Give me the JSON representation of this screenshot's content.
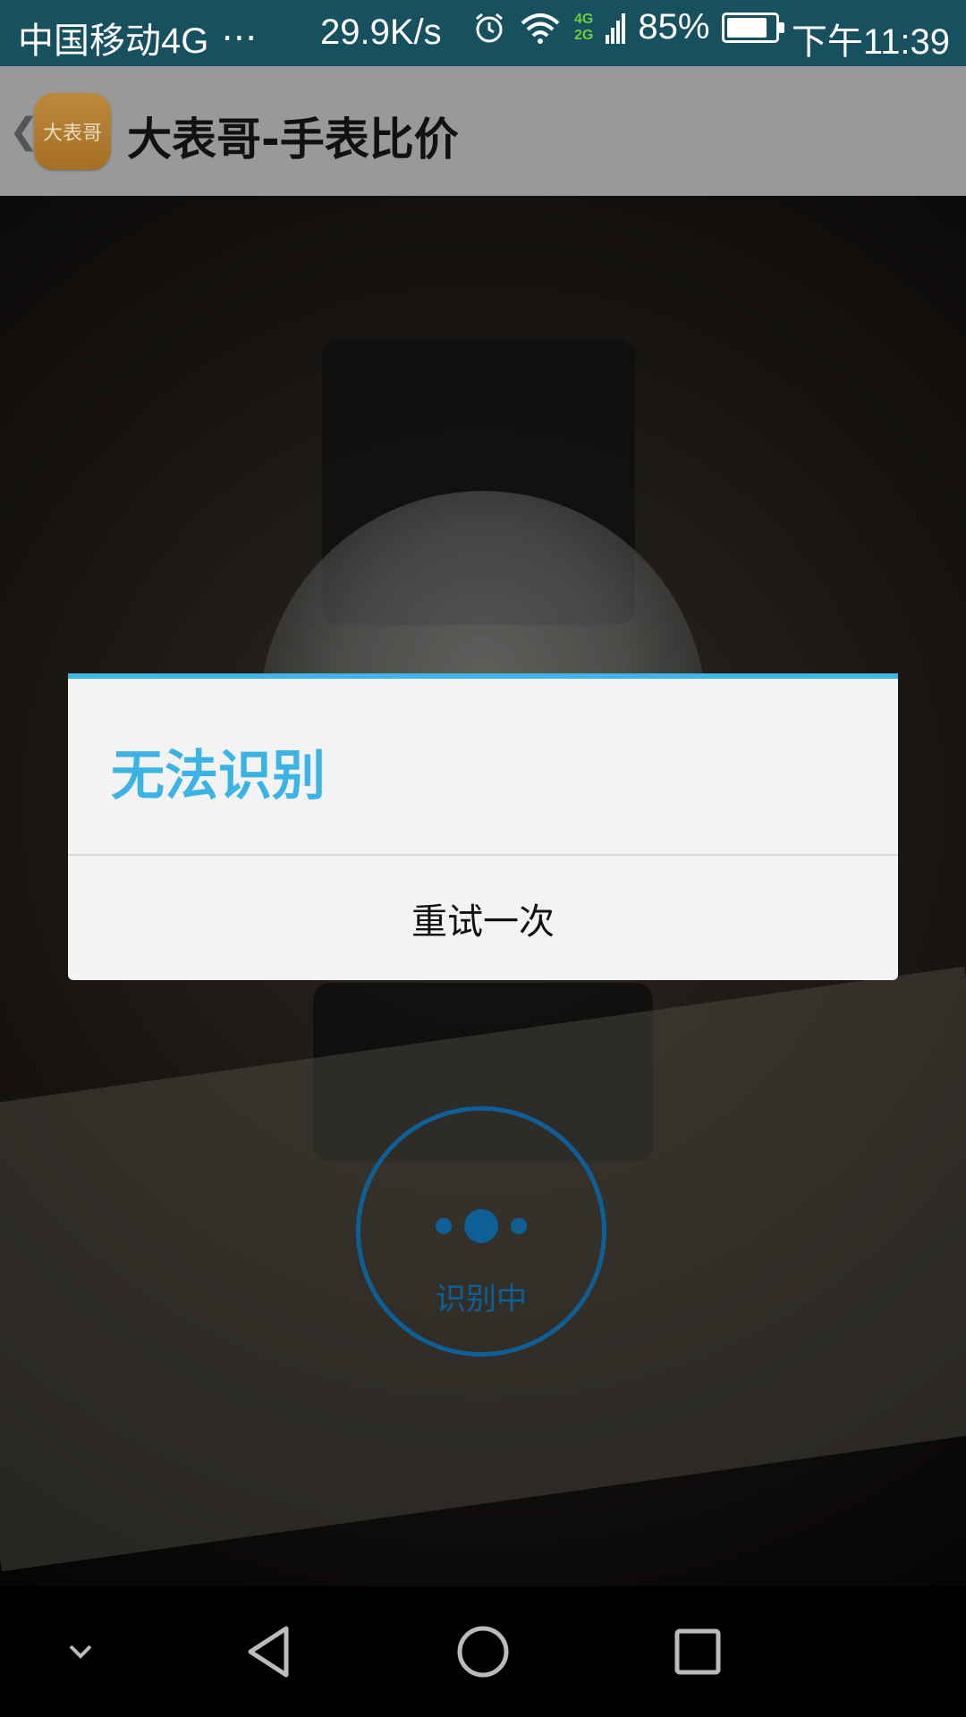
{
  "status_bar": {
    "carrier": "中国移动4G",
    "more": "⋯",
    "net_speed": "29.9K/s",
    "network_type_top": "4G",
    "network_type_bottom": "2G",
    "battery_percent": "85%",
    "battery_level": 0.85,
    "time": "下午11:39"
  },
  "app_bar": {
    "logo_text": "大表哥",
    "title": "大表哥-手表比价"
  },
  "scan": {
    "label": "识别中"
  },
  "dialog": {
    "title": "无法识别",
    "button_label": "重试一次"
  },
  "colors": {
    "accent": "#41b6e6",
    "scan_blue": "#0f5f97"
  }
}
